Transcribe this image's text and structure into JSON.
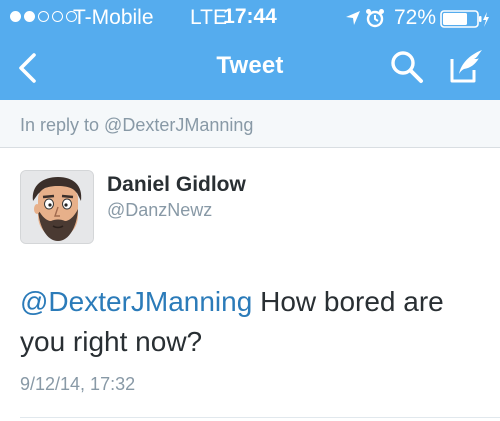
{
  "status_bar": {
    "carrier": "T-Mobile",
    "network": "LTE",
    "time": "17:44",
    "battery": "72%",
    "signal_bars": 2,
    "signal_total": 5
  },
  "nav": {
    "title": "Tweet",
    "icons": [
      "back-chevron-icon",
      "search-icon",
      "compose-tweet-icon"
    ]
  },
  "reply": {
    "text": "In reply to @DexterJManning"
  },
  "tweet": {
    "author_name": "Daniel Gidlow",
    "author_handle": "@DanzNewz",
    "mention": "@DexterJManning",
    "body": " How bored are you right now?",
    "timestamp": "9/12/14, 17:32"
  },
  "colors": {
    "header_blue": "#55acee",
    "link_blue": "#2b7bb9",
    "muted_gray": "#8899a6",
    "text": "#292f33"
  }
}
